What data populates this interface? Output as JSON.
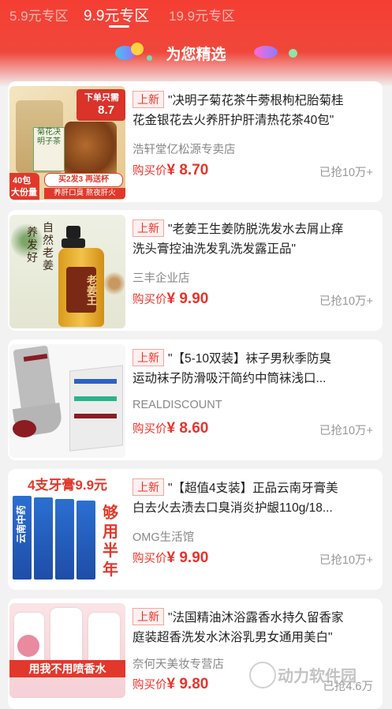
{
  "tabs": [
    {
      "label": "5.9元专区"
    },
    {
      "label": "9.9元专区"
    },
    {
      "label": "19.9元专区"
    }
  ],
  "active_tab": "9.9元专区",
  "section_title": "为您精选",
  "products": [
    {
      "badge": "上新",
      "title_line1": "\"决明子菊花茶牛蒡根枸杞胎菊桂",
      "title_line2": "花金银花去火养肝护肝清热花茶40包\"",
      "shop": "浩轩堂亿松源专卖店",
      "price_label": "购买价",
      "price": "¥ 8.70",
      "sold": "已抢10万+",
      "image_text": {
        "promo": "下单只需",
        "promo_price": "8.7",
        "count": "40包",
        "count_sub": "大份量",
        "deal": "买2发3 再送杯",
        "slogan": "养肝口臭 熬夜肝火",
        "pack": "菊花决明子茶"
      }
    },
    {
      "badge": "上新",
      "title_line1": "\"老姜王生姜防脱洗发水去屑止痒",
      "title_line2": "洗头膏控油洗发乳洗发露正品\"",
      "shop": "三丰企业店",
      "price_label": "购买价",
      "price": "¥ 9.90",
      "sold": "已抢10万+",
      "image_text": {
        "calligraphy1": "自然老姜",
        "calligraphy2": "养发好",
        "bottle": "老姜王"
      }
    },
    {
      "badge": "上新",
      "title_line1": "\"【5-10双装】袜子男秋季防臭",
      "title_line2": "运动袜子防滑吸汗简约中筒袜浅口...",
      "shop": "REALDISCOUNT",
      "price_label": "购买价",
      "price": "¥ 8.60",
      "sold": "已抢10万+"
    },
    {
      "badge": "上新",
      "title_line1": "\"【超值4支装】正品云南牙膏美",
      "title_line2": "白去火去渍去口臭消炎护龈110g/18...",
      "shop": "OMG生活馆",
      "price_label": "购买价",
      "price": "¥ 9.90",
      "sold": "已抢10万+",
      "image_text": {
        "headline": "4支牙膏9.9元",
        "side": "够用半年",
        "brand": "云南中药"
      }
    },
    {
      "badge": "上新",
      "title_line1": "\"法国精油沐浴露香水持久留香家",
      "title_line2": "庭装超香洗发水沐浴乳男女通用美白\"",
      "shop": "奈何天美妆专营店",
      "price_label": "购买价",
      "price": "¥ 9.80",
      "sold": "已抢4.6万",
      "image_text": {
        "banner": "用我不用喷香水"
      }
    }
  ],
  "watermark": "动力软件园",
  "colors": {
    "accent": "#e8332a",
    "header": "#f53e33"
  }
}
